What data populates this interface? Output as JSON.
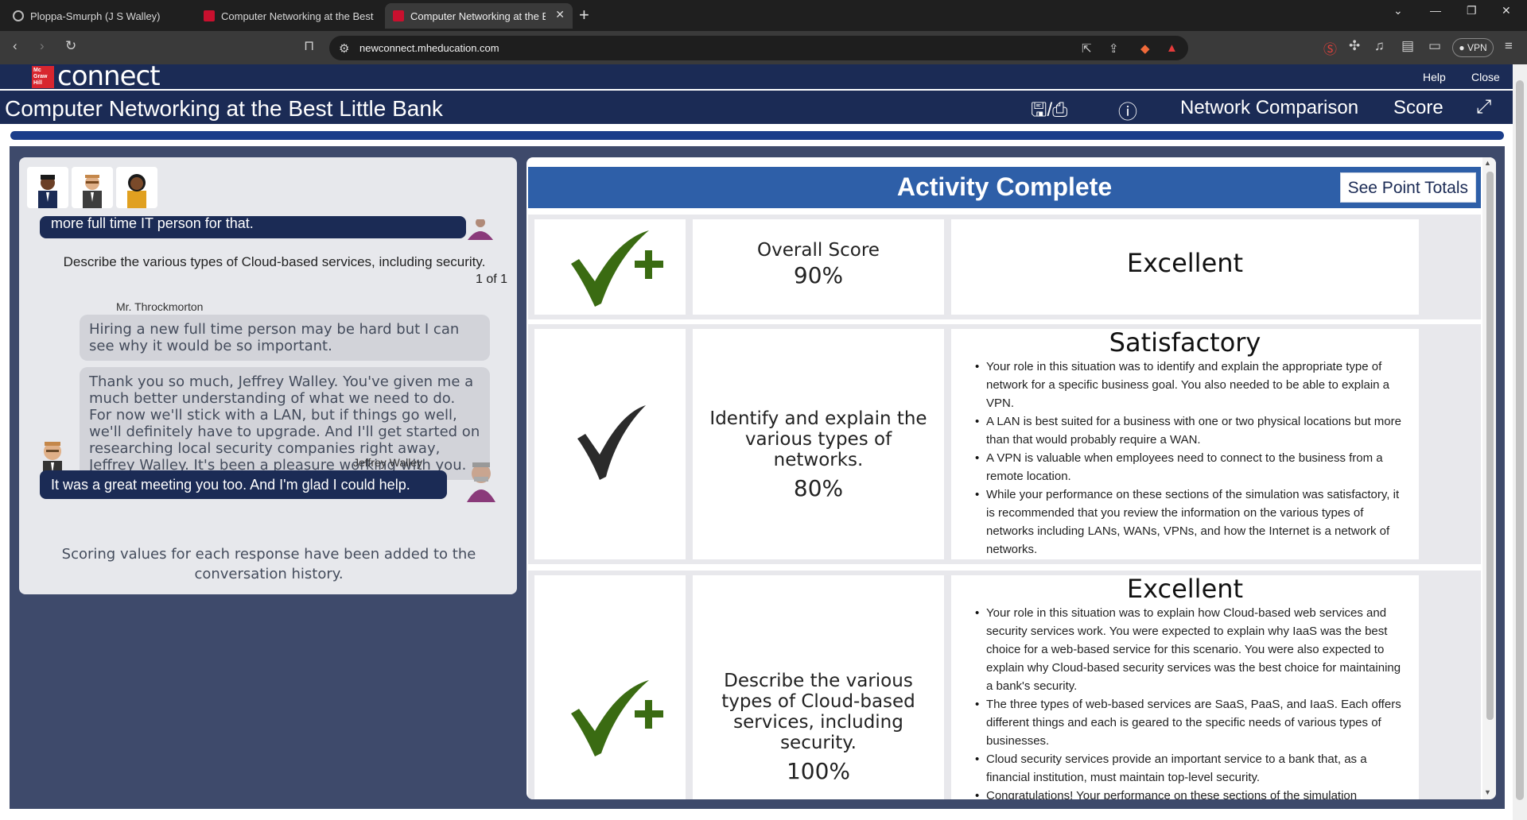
{
  "browser": {
    "tabs": [
      {
        "title": "Ploppa-Smurph (J S Walley)"
      },
      {
        "title": "Computer Networking at the Best Li"
      },
      {
        "title": "Computer Networking at the Be"
      }
    ],
    "url": "newconnect.mheducation.com",
    "vpn_label": "VPN"
  },
  "header": {
    "logo_small": "Mc Graw Hill",
    "logo_text": "connect",
    "help": "Help",
    "close": "Close"
  },
  "titlebar": {
    "title": "Computer Networking at the Best Little Bank",
    "save_print_icon": "save-print-icon",
    "help_icon": "help-circle-icon",
    "network_comparison": "Network Comparison",
    "score": "Score",
    "expand_icon": "expand-icon"
  },
  "conversation": {
    "cut_message": "more full time IT person for that.",
    "prompt": "Describe the various types of Cloud-based services, including security.",
    "count": "1 of 1",
    "speaker1": "Mr. Throckmorton",
    "msg1": "Hiring a new full time person may be hard but I can see why it would be so important.",
    "msg2": "Thank you so much, Jeffrey Walley. You've given me a much better understanding of what we need to do. For now we'll stick with a LAN, but if things go well, we'll definitely have to upgrade. And I'll get started on researching local security companies right away, Jeffrey Walley. It's been a pleasure working with you.",
    "speaker2": "Jeffrey Walley",
    "reply": "It was a great meeting you too. And I'm glad I could help.",
    "scoring_note": "Scoring values for each response have been added to the conversation history."
  },
  "results": {
    "title": "Activity Complete",
    "see_totals": "See Point Totals",
    "overall": {
      "label": "Overall Score",
      "score": "90%",
      "rating": "Excellent"
    },
    "sections": [
      {
        "label": "Identify and explain the various types of networks.",
        "score": "80%",
        "rating": "Satisfactory",
        "bullets": [
          "Your role in this situation was to identify and explain the appropriate type of network for a specific business goal. You also needed to be able to explain a VPN.",
          "A LAN is best suited for a business with one or two physical locations but more than that would probably require a WAN.",
          "A VPN is valuable when employees need to connect to the business from a remote location.",
          "While your performance on these sections of the simulation was satisfactory, it is recommended that you review the information on the various types of networks including LANs, WANs, VPNs, and how the Internet is a network of networks."
        ]
      },
      {
        "label": "Describe the various types of Cloud-based services, including security.",
        "score": "100%",
        "rating": "Excellent",
        "bullets": [
          "Your role in this situation was to explain how Cloud-based web services and security services work. You were expected to explain why IaaS was the best choice for a web-based service for this scenario. You were also expected to explain why Cloud-based security services was the best choice for maintaining a bank's security.",
          "The three types of web-based services are SaaS, PaaS, and IaaS. Each offers different things and each is geared to the specific needs of various types of businesses.",
          "Cloud security services provide an important service to a bank that, as a financial institution, must maintain top-level security.",
          "Congratulations! Your performance on these sections of the simulation"
        ]
      }
    ]
  },
  "colors": {
    "navy": "#1b2b55",
    "result_blue": "#2e5fa8",
    "check_green": "#3a6b12",
    "check_dark": "#2b2b2b"
  }
}
